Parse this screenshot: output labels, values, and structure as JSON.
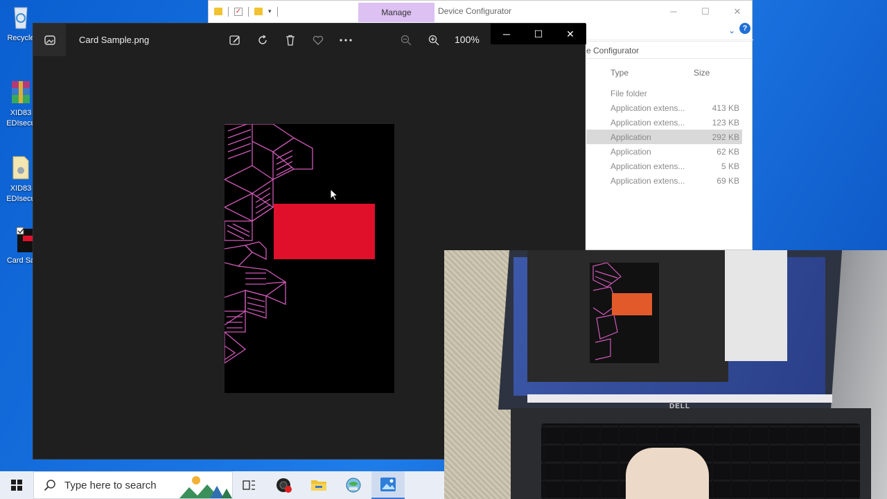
{
  "desktop": {
    "icons": [
      {
        "label": "Recycle"
      },
      {
        "label": "XID83\nEDIsecu"
      },
      {
        "label": "XID83\nEDIsecu"
      },
      {
        "label": "Card Sa"
      }
    ]
  },
  "explorer": {
    "manage_tab": "Manage",
    "title": "Device Configurator",
    "address": "e Configurator",
    "col_type": "Type",
    "col_size": "Size",
    "rows": [
      {
        "type": "File folder",
        "size": ""
      },
      {
        "type": "Application extens...",
        "size": "413 KB"
      },
      {
        "type": "Application extens...",
        "size": "123 KB"
      },
      {
        "type": "Application",
        "size": "292 KB",
        "selected": true
      },
      {
        "type": "Application",
        "size": "62 KB"
      },
      {
        "type": "Application extens...",
        "size": "5 KB"
      },
      {
        "type": "Application extens...",
        "size": "69 KB"
      }
    ],
    "help_glyph": "?"
  },
  "photos": {
    "title": "Card Sample.png",
    "zoom": "100%",
    "colors": {
      "card_red": "#e0102a",
      "pattern": "#d05ab8"
    }
  },
  "webcam": {
    "brand": "DELL"
  },
  "taskbar": {
    "search_placeholder": "Type here to search"
  }
}
